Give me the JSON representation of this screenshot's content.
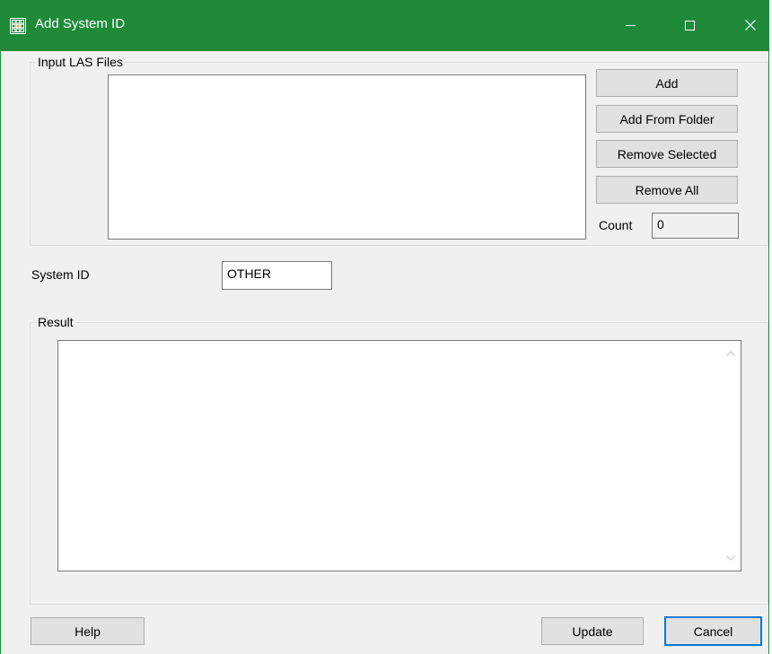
{
  "window": {
    "title": "Add System ID",
    "icons": [
      "app-grid-icon",
      "minimize-icon",
      "maximize-icon",
      "close-icon"
    ]
  },
  "input_group": {
    "legend": "Input LAS Files",
    "buttons": {
      "add": "Add",
      "add_from_folder": "Add From Folder",
      "remove_selected": "Remove Selected",
      "remove_all": "Remove All"
    },
    "count_label": "Count",
    "count_value": "0"
  },
  "system_id": {
    "label": "System ID",
    "value": "OTHER"
  },
  "result_group": {
    "legend": "Result"
  },
  "footer": {
    "help": "Help",
    "update": "Update",
    "cancel": "Cancel"
  },
  "colors": {
    "titlebar": "#1e8a3a",
    "background": "#f0f0f0",
    "focus": "#0078d7"
  }
}
